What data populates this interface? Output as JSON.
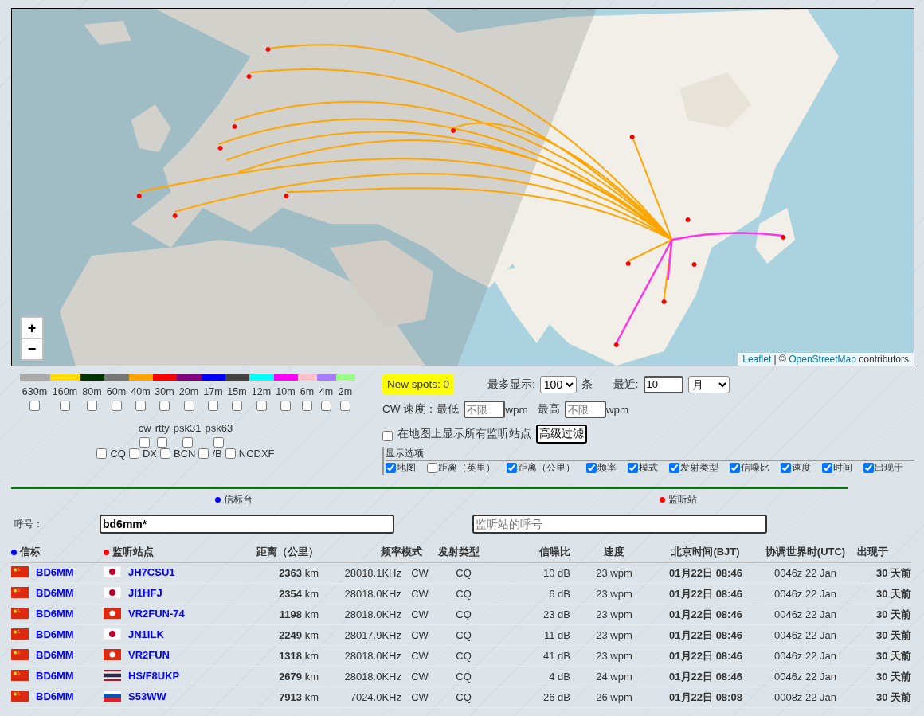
{
  "map": {
    "zoom_in": "+",
    "zoom_out": "−",
    "attribution": {
      "link_1": "Leaflet",
      "middle": "| ©",
      "link_2": "OpenStreetMap",
      "suffix": "contributors"
    }
  },
  "bands": [
    {
      "label": "630m",
      "color": "#aaaaaa",
      "checked": false
    },
    {
      "label": "160m",
      "color": "#ffdd00",
      "checked": false
    },
    {
      "label": "80m",
      "color": "#003300",
      "checked": false
    },
    {
      "label": "60m",
      "color": "#777777",
      "checked": false
    },
    {
      "label": "40m",
      "color": "#ffa500",
      "checked": false
    },
    {
      "label": "30m",
      "color": "#ff0000",
      "checked": false
    },
    {
      "label": "20m",
      "color": "#800080",
      "checked": false
    },
    {
      "label": "17m",
      "color": "#0000ff",
      "checked": false
    },
    {
      "label": "15m",
      "color": "#444444",
      "checked": false
    },
    {
      "label": "12m",
      "color": "#00ffff",
      "checked": false
    },
    {
      "label": "10m",
      "color": "#ff00ff",
      "checked": false
    },
    {
      "label": "6m",
      "color": "#ffc0cb",
      "checked": false
    },
    {
      "label": "4m",
      "color": "#a97bff",
      "checked": false
    },
    {
      "label": "2m",
      "color": "#99ff88",
      "checked": false
    }
  ],
  "modes": [
    {
      "label": "cw",
      "checked": false
    },
    {
      "label": "rtty",
      "checked": false
    },
    {
      "label": "psk31",
      "checked": false
    },
    {
      "label": "psk63",
      "checked": false
    }
  ],
  "types": [
    {
      "label": "CQ",
      "checked": false
    },
    {
      "label": "DX",
      "checked": false
    },
    {
      "label": "BCN",
      "checked": false
    },
    {
      "label": "/B",
      "checked": false
    },
    {
      "label": "NCDXF",
      "checked": false
    }
  ],
  "new_spots": "New spots: 0",
  "max_label": "最多显示:",
  "max_value": "100",
  "max_unit": "条",
  "recent_label": "最近:",
  "recent_value": "10",
  "recent_unit": "月",
  "speed": {
    "label": "CW 速度：最低",
    "min_placeholder": "不限",
    "unit_1": "wpm",
    "max_label": "最高",
    "max_placeholder": "不限",
    "unit_2": "wpm"
  },
  "show_all": {
    "label": "在地图上显示所有监听站点",
    "checked": false
  },
  "advanced_button": "高级过滤",
  "display_options": {
    "legend": "显示选项",
    "items": [
      {
        "label": "地图",
        "checked": true
      },
      {
        "label": "距离（英里）",
        "checked": false
      },
      {
        "label": "距离（公里）",
        "checked": true
      },
      {
        "label": "频率",
        "checked": true
      },
      {
        "label": "模式",
        "checked": true
      },
      {
        "label": "发射类型",
        "checked": true
      },
      {
        "label": "信噪比",
        "checked": true
      },
      {
        "label": "速度",
        "checked": true
      },
      {
        "label": "时间",
        "checked": true
      },
      {
        "label": "出现于",
        "checked": true
      }
    ]
  },
  "sections": [
    {
      "label": "信标台",
      "color": "#0000ff"
    },
    {
      "label": "监听站",
      "color": "#ff0000"
    }
  ],
  "callsign_label": "呼号：",
  "beacon_value": "bd6mm*",
  "listener_placeholder": "监听站的呼号",
  "columns": [
    {
      "label": "信标",
      "color": "#0000ff"
    },
    {
      "label": "监听站点",
      "color": "#ff0000"
    },
    {
      "label": "距离（公里）"
    },
    {
      "label": "频率"
    },
    {
      "label": "模式"
    },
    {
      "label": "发射类型"
    },
    {
      "label": "信噪比"
    },
    {
      "label": "速度"
    },
    {
      "label": "北京时间(BJT)"
    },
    {
      "label": "协调世界时(UTC)"
    },
    {
      "label": "出现于"
    }
  ],
  "rows": [
    {
      "beacon_flag": {
        "kind": "cn"
      },
      "beacon": "BD6MM",
      "listener_flag": {
        "kind": "jp"
      },
      "listener": "JH7CSU1",
      "distance": "**2363** km",
      "freq": "28018.1KHz",
      "mode": "CW",
      "type": "CQ",
      "snr": "10 dB",
      "speed": "23 wpm",
      "bjt": "01月22日 08:46",
      "utc": "0046z 22 Jan",
      "seen": "30 天前"
    },
    {
      "beacon_flag": {
        "kind": "cn"
      },
      "beacon": "BD6MM",
      "listener_flag": {
        "kind": "jp"
      },
      "listener": "JI1HFJ",
      "distance": "**2354** km",
      "freq": "28018.0KHz",
      "mode": "CW",
      "type": "CQ",
      "snr": "6 dB",
      "speed": "23 wpm",
      "bjt": "01月22日 08:46",
      "utc": "0046z 22 Jan",
      "seen": "30 天前"
    },
    {
      "beacon_flag": {
        "kind": "cn"
      },
      "beacon": "BD6MM",
      "listener_flag": {
        "kind": "hk"
      },
      "listener": "VR2FUN-74",
      "distance": "**1198** km",
      "freq": "28018.0KHz",
      "mode": "CW",
      "type": "CQ",
      "snr": "23 dB",
      "speed": "23 wpm",
      "bjt": "01月22日 08:46",
      "utc": "0046z 22 Jan",
      "seen": "30 天前"
    },
    {
      "beacon_flag": {
        "kind": "cn"
      },
      "beacon": "BD6MM",
      "listener_flag": {
        "kind": "jp"
      },
      "listener": "JN1ILK",
      "distance": "**2249** km",
      "freq": "28017.9KHz",
      "mode": "CW",
      "type": "CQ",
      "snr": "11 dB",
      "speed": "23 wpm",
      "bjt": "01月22日 08:46",
      "utc": "0046z 22 Jan",
      "seen": "30 天前"
    },
    {
      "beacon_flag": {
        "kind": "cn"
      },
      "beacon": "BD6MM",
      "listener_flag": {
        "kind": "hk"
      },
      "listener": "VR2FUN",
      "distance": "**1318** km",
      "freq": "28018.0KHz",
      "mode": "CW",
      "type": "CQ",
      "snr": "41 dB",
      "speed": "23 wpm",
      "bjt": "01月22日 08:46",
      "utc": "0046z 22 Jan",
      "seen": "30 天前"
    },
    {
      "beacon_flag": {
        "kind": "cn"
      },
      "beacon": "BD6MM",
      "listener_flag": {
        "kind": "th"
      },
      "listener": "HS/F8UKP",
      "distance": "**2679** km",
      "freq": "28018.0KHz",
      "mode": "CW",
      "type": "CQ",
      "snr": "4 dB",
      "speed": "24 wpm",
      "bjt": "01月22日 08:46",
      "utc": "0046z 22 Jan",
      "seen": "30 天前"
    },
    {
      "beacon_flag": {
        "kind": "cn"
      },
      "beacon": "BD6MM",
      "listener_flag": {
        "kind": "si"
      },
      "listener": "S53WW",
      "distance": "**7913** km",
      "freq": "7024.0KHz",
      "mode": "CW",
      "type": "CQ",
      "snr": "26 dB",
      "speed": "26 wpm",
      "bjt": "01月22日 08:08",
      "utc": "0008z 22 Jan",
      "seen": "30 天前"
    }
  ]
}
